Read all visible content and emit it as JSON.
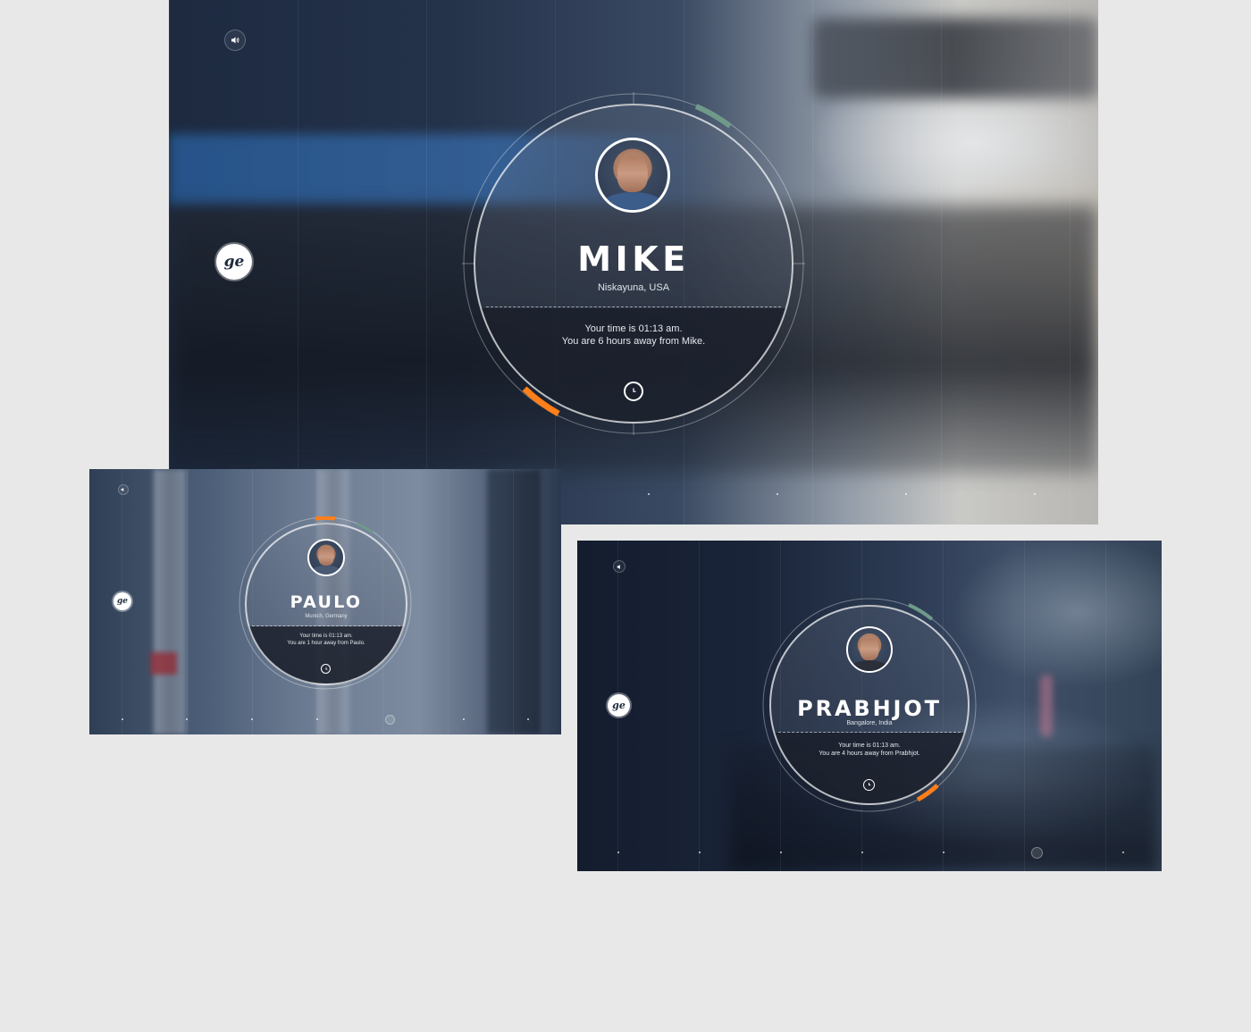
{
  "screens": [
    {
      "name": "MIKE",
      "location": "Niskayuna, USA",
      "time_line": "Your time is 01:13 am.",
      "away_line": "You are 6 hours away from Mike."
    },
    {
      "name": "PAULO",
      "location": "Munich, Germany",
      "time_line": "Your time is 01:13 am.",
      "away_line": "You are 1 hour away from Paulo."
    },
    {
      "name": "PRABHJOT",
      "location": "Bangalore, India",
      "time_line": "Your time is 01:13 am.",
      "away_line": "You are 4 hours away from Prabhjot."
    }
  ],
  "icons": {
    "sound": "speaker-icon",
    "logo": "ge-logo",
    "clock": "clock-icon"
  },
  "colors": {
    "accent_orange": "#ff7f1a",
    "accent_green": "#6f9a8a",
    "page_bg": "#e8e8e8"
  }
}
